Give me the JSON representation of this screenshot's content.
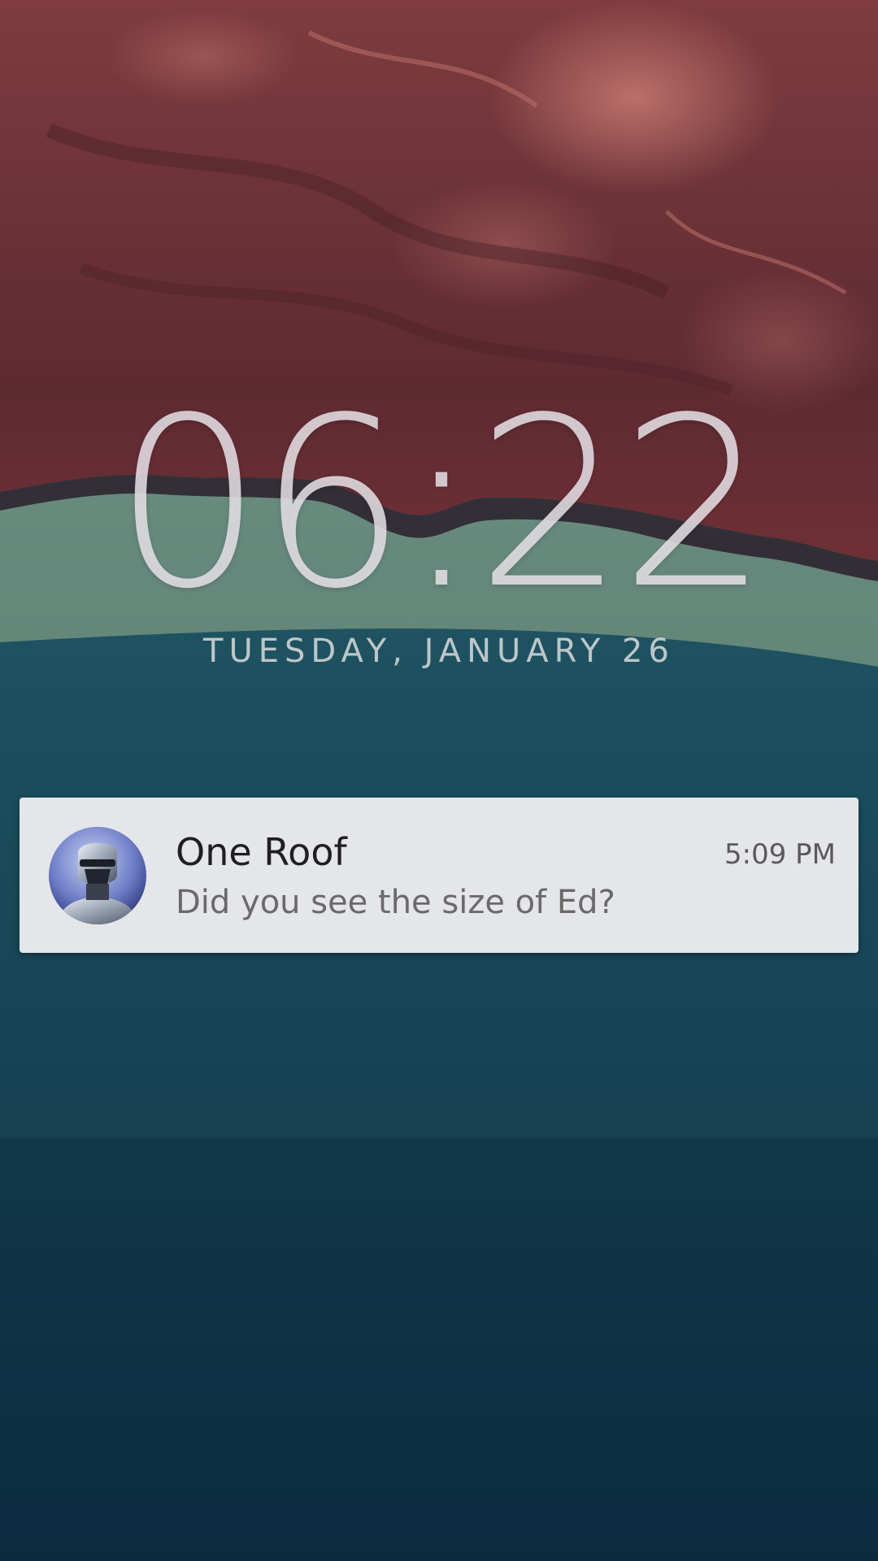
{
  "lockscreen": {
    "time": "06:22",
    "date": "TUESDAY, JANUARY 26"
  },
  "notification": {
    "avatar_icon": "robot-avatar-icon",
    "title": "One Roof",
    "message": "Did you see the size of Ed?",
    "time": "5:09 PM"
  },
  "colors": {
    "card_background": "#e4e6e9",
    "wallpaper_red": "#7a3a3e",
    "wallpaper_green": "#b8c59a",
    "wallpaper_teal": "#1b4f5c"
  }
}
